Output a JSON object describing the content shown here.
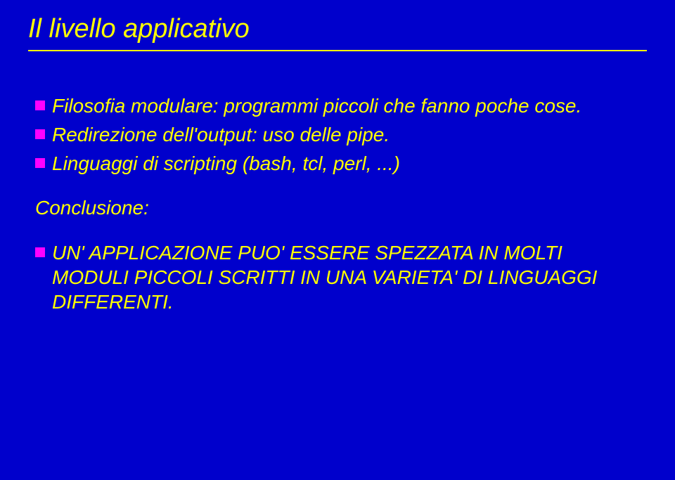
{
  "title": "Il livello applicativo",
  "bullets": {
    "b1": "Filosofia modulare: programmi piccoli che fanno poche cose.",
    "b2": "Redirezione dell'output: uso delle pipe.",
    "b3": "Linguaggi di scripting (bash, tcl, perl, ...)"
  },
  "conclusion_label": "Conclusione:",
  "conclusion_bullet": "UN' APPLICAZIONE PUO' ESSERE SPEZZATA IN MOLTI MODULI PICCOLI SCRITTI IN UNA VARIETA' DI LINGUAGGI DIFFERENTI."
}
